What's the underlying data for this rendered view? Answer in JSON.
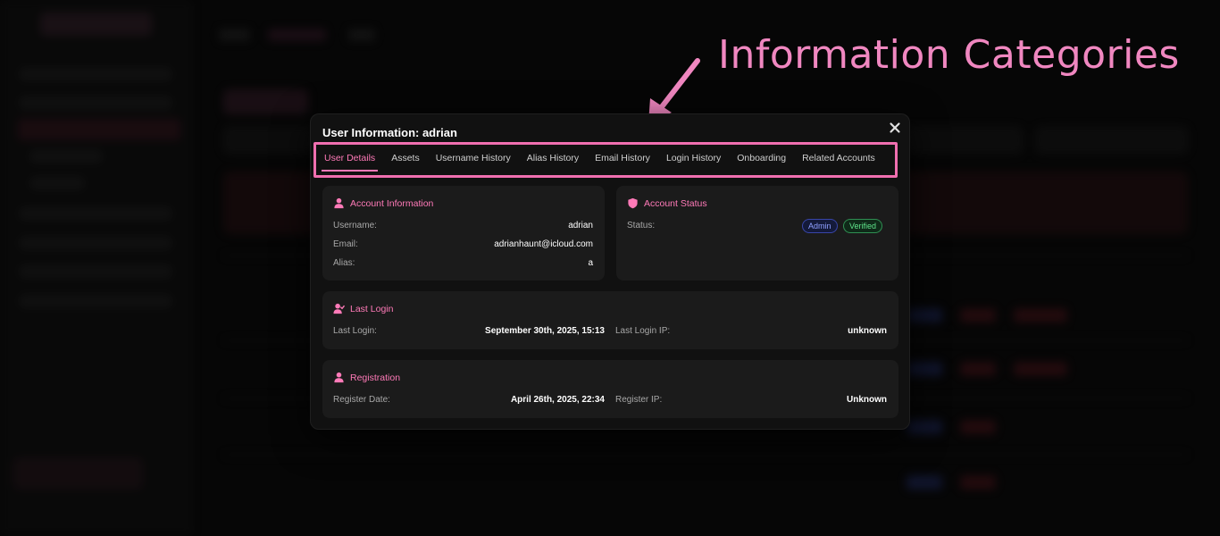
{
  "annotation": {
    "label": "Information Categories",
    "color": "#f087c0"
  },
  "modal": {
    "title": "User Information: adrian",
    "close_icon": "close-icon",
    "tabs": [
      {
        "label": "User Details",
        "active": true
      },
      {
        "label": "Assets",
        "active": false
      },
      {
        "label": "Username History",
        "active": false
      },
      {
        "label": "Alias History",
        "active": false
      },
      {
        "label": "Email History",
        "active": false
      },
      {
        "label": "Login History",
        "active": false
      },
      {
        "label": "Onboarding",
        "active": false
      },
      {
        "label": "Related Accounts",
        "active": false
      }
    ],
    "account_information": {
      "heading": "Account Information",
      "icon": "user-icon",
      "username_label": "Username:",
      "username_value": "adrian",
      "email_label": "Email:",
      "email_value": "adrianhaunt@icloud.com",
      "alias_label": "Alias:",
      "alias_value": "a"
    },
    "account_status": {
      "heading": "Account Status",
      "icon": "shield-icon",
      "status_label": "Status:",
      "badges": [
        "Admin",
        "Verified"
      ]
    },
    "last_login": {
      "heading": "Last Login",
      "icon": "user-check-icon",
      "last_login_label": "Last Login:",
      "last_login_value": "September 30th, 2025, 15:13",
      "ip_label": "Last Login IP:",
      "ip_value": "unknown"
    },
    "registration": {
      "heading": "Registration",
      "icon": "user-icon",
      "date_label": "Register Date:",
      "date_value": "April 26th, 2025, 22:34",
      "ip_label": "Register IP:",
      "ip_value": "Unknown"
    }
  },
  "colors": {
    "accent": "#ff7ab8",
    "admin_badge": "#8fa0ff",
    "verified_badge": "#5fe38a"
  }
}
